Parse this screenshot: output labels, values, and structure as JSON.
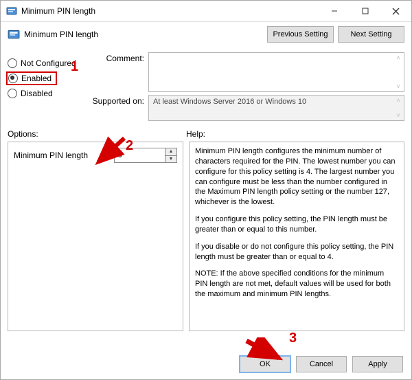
{
  "window": {
    "title": "Minimum PIN length",
    "min_label": "—",
    "max_label": "□",
    "close_label": "✕"
  },
  "header": {
    "title": "Minimum PIN length",
    "prev_button": "Previous Setting",
    "next_button": "Next Setting"
  },
  "state": {
    "not_configured": "Not Configured",
    "enabled": "Enabled",
    "disabled": "Disabled",
    "selected": "enabled"
  },
  "fields": {
    "comment_label": "Comment:",
    "comment_value": "",
    "supported_label": "Supported on:",
    "supported_value": "At least Windows Server 2016 or Windows 10"
  },
  "mid": {
    "options_label": "Options:",
    "help_label": "Help:"
  },
  "options": {
    "pin_length_label": "Minimum PIN length",
    "pin_length_value": "6"
  },
  "help": {
    "p1": "Minimum PIN length configures the minimum number of characters required for the PIN.  The lowest number you can configure for this policy setting is 4.  The largest number you can configure must be less than the number configured in the Maximum PIN length policy setting or the number 127, whichever is the lowest.",
    "p2": "If you configure this policy setting, the PIN length must be greater than or equal to this number.",
    "p3": "If you disable or do not configure this policy setting, the PIN length must be greater than or equal to 4.",
    "p4": "NOTE: If the above specified conditions for the minimum PIN length are not met, default values will be used for both the maximum and minimum PIN lengths."
  },
  "footer": {
    "ok": "OK",
    "cancel": "Cancel",
    "apply": "Apply"
  },
  "annotations": {
    "n1": "1",
    "n2": "2",
    "n3": "3"
  }
}
